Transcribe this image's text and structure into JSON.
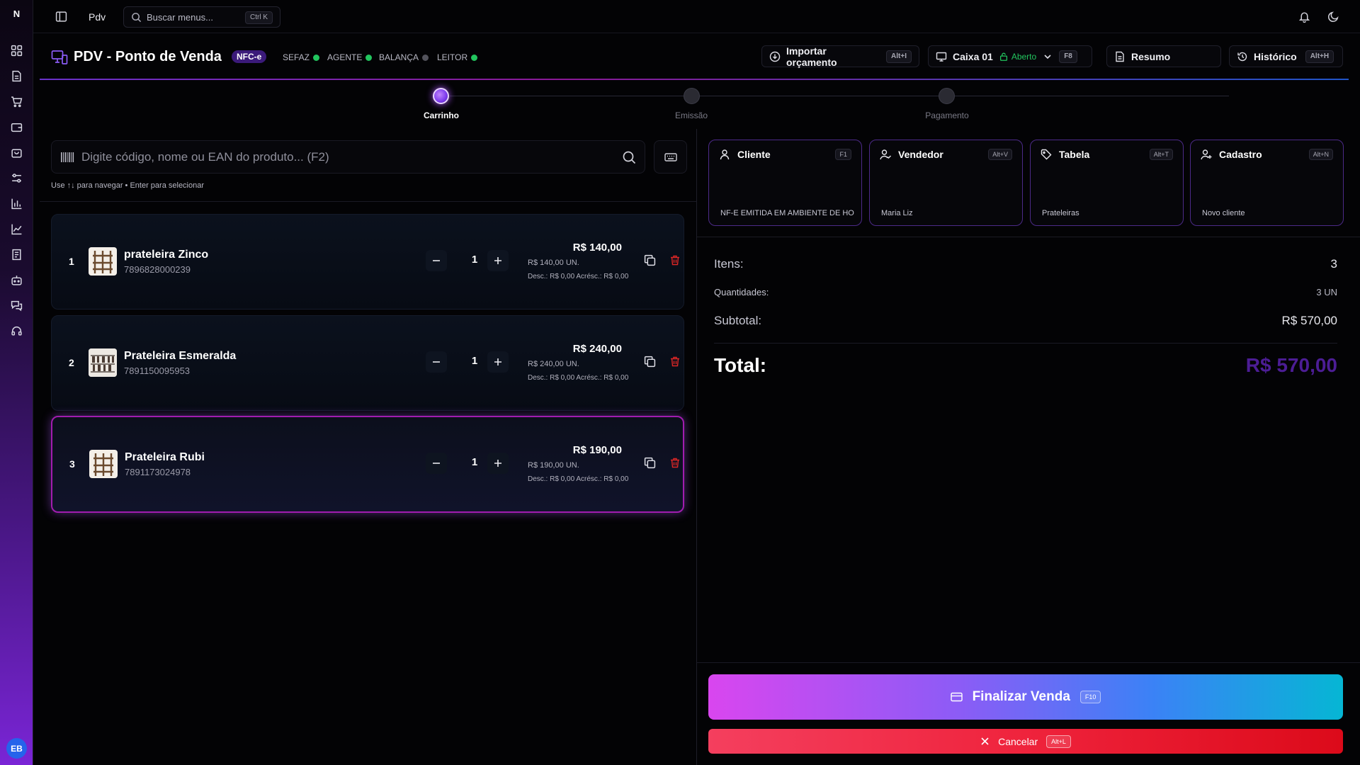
{
  "rail": {
    "logo": "N",
    "avatar": "EB",
    "icons": [
      "dashboard-icon",
      "document-icon",
      "cart-icon",
      "wallet-icon",
      "bag-icon",
      "sliders-icon",
      "bar-chart-icon",
      "area-chart-icon",
      "receipt-icon",
      "bot-icon",
      "chat-icon",
      "headset-icon"
    ]
  },
  "topbar": {
    "title": "Pdv",
    "search_placeholder": "Buscar menus...",
    "search_shortcut": "Ctrl K"
  },
  "header": {
    "title": "PDV - Ponto de Venda",
    "badge": "NFC-e",
    "statuses": [
      {
        "label": "SEFAZ",
        "color": "#22c55e"
      },
      {
        "label": "AGENTE",
        "color": "#22c55e"
      },
      {
        "label": "BALANÇA",
        "color": "#52525b"
      },
      {
        "label": "LEITOR",
        "color": "#22c55e"
      }
    ],
    "import_label": "Importar orçamento",
    "import_shortcut": "Alt+I",
    "caixa_label": "Caixa 01",
    "caixa_status": "Aberto",
    "caixa_shortcut": "F8",
    "resumo_label": "Resumo",
    "historico_label": "Histórico",
    "historico_shortcut": "Alt+H"
  },
  "steps": [
    {
      "label": "Carrinho",
      "active": true
    },
    {
      "label": "Emissão",
      "active": false
    },
    {
      "label": "Pagamento",
      "active": false
    }
  ],
  "search": {
    "placeholder": "Digite código, nome ou EAN do produto... (F2)",
    "hint": "Use ↑↓ para navegar • Enter para selecionar"
  },
  "cart": [
    {
      "index": "1",
      "name": "prateleira Zinco",
      "ean": "7896828000239",
      "qty": "1",
      "price": "R$ 140,00",
      "unit_price": "R$ 140,00 UN.",
      "discounts": "Desc.: R$ 0,00   Acrésc.: R$ 0,00",
      "selected": false
    },
    {
      "index": "2",
      "name": "Prateleira Esmeralda",
      "ean": "7891150095953",
      "qty": "1",
      "price": "R$ 240,00",
      "unit_price": "R$ 240,00 UN.",
      "discounts": "Desc.: R$ 0,00   Acrésc.: R$ 0,00",
      "selected": false
    },
    {
      "index": "3",
      "name": "Prateleira Rubi",
      "ean": "7891173024978",
      "qty": "1",
      "price": "R$ 190,00",
      "unit_price": "R$ 190,00 UN.",
      "discounts": "Desc.: R$ 0,00   Acrésc.: R$ 0,00",
      "selected": true
    }
  ],
  "info_cards": [
    {
      "title": "Cliente",
      "shortcut": "F1",
      "value": "NF-E EMITIDA EM AMBIENTE DE HO",
      "icon": "user-icon"
    },
    {
      "title": "Vendedor",
      "shortcut": "Alt+V",
      "value": "Maria Liz",
      "icon": "user-check-icon"
    },
    {
      "title": "Tabela",
      "shortcut": "Alt+T",
      "value": "Prateleiras",
      "icon": "tag-icon"
    },
    {
      "title": "Cadastro",
      "shortcut": "Alt+N",
      "value": "Novo cliente",
      "icon": "user-plus-icon"
    }
  ],
  "summary": {
    "itens_label": "Itens:",
    "itens_value": "3",
    "qtd_label": "Quantidades:",
    "qtd_value": "3 UN",
    "subtotal_label": "Subtotal:",
    "subtotal_value": "R$ 570,00",
    "total_label": "Total:",
    "total_value": "R$ 570,00",
    "total_color": "#4c1d95"
  },
  "actions": {
    "finalize_label": "Finalizar Venda",
    "finalize_shortcut": "F10",
    "cancel_label": "Cancelar",
    "cancel_shortcut": "Alt+L"
  }
}
